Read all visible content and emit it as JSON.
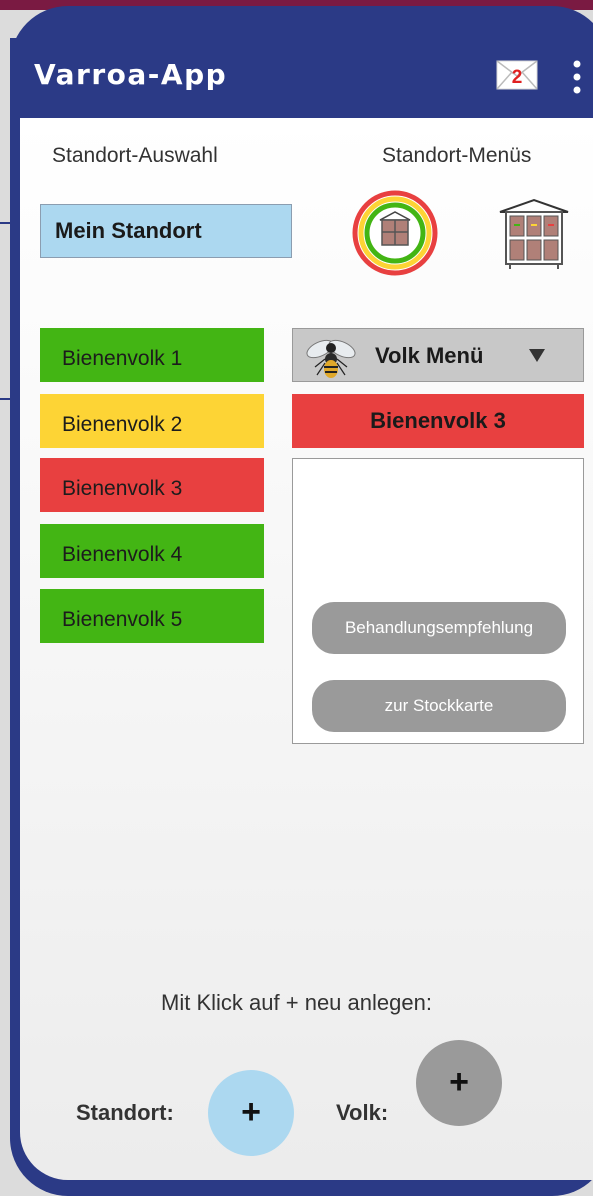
{
  "app": {
    "title": "Varroa-App",
    "message_count": "2"
  },
  "headers": {
    "location_select": "Standort-Auswahl",
    "location_menus": "Standort-Menüs"
  },
  "location": {
    "selected": "Mein Standort"
  },
  "colonies": [
    {
      "label": "Bienenvolk 1",
      "status_color": "#43b514"
    },
    {
      "label": "Bienenvolk 2",
      "status_color": "#fdd435"
    },
    {
      "label": "Bienenvolk 3",
      "status_color": "#e84040"
    },
    {
      "label": "Bienenvolk 4",
      "status_color": "#43b514"
    },
    {
      "label": "Bienenvolk 5",
      "status_color": "#43b514"
    }
  ],
  "volk_menu": {
    "label": "Volk Menü",
    "selected": "Bienenvolk 3",
    "actions": {
      "treatment": "Behandlungsempfehlung",
      "hive_card": "zur Stockkarte"
    }
  },
  "add": {
    "hint": "Mit Klick auf + neu anlegen:",
    "location_label": "Standort:",
    "colony_label": "Volk:",
    "plus": "+",
    "location_button_color": "#acd8f0",
    "colony_button_color": "#9a9a9a"
  },
  "icons": [
    "envelope-icon",
    "more-vert-icon",
    "hive-status-icon",
    "hive-icon",
    "bee-icon",
    "caret-down-icon"
  ]
}
